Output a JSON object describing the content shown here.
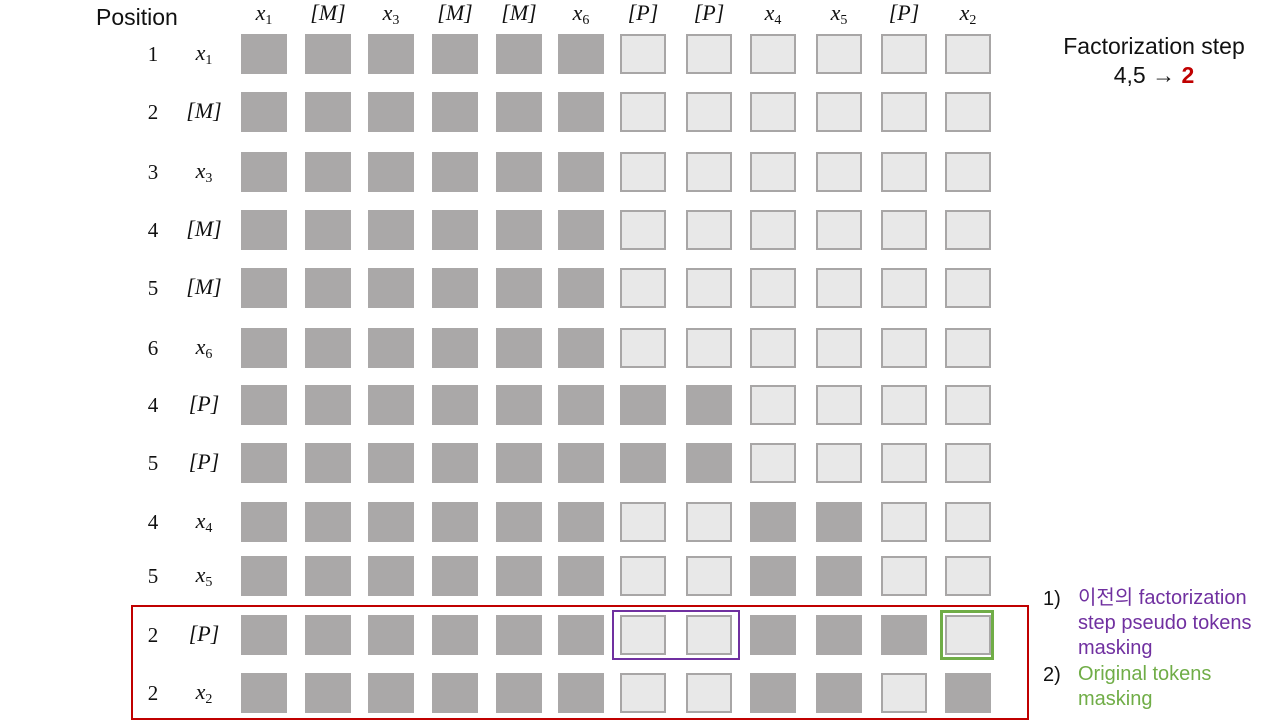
{
  "header": {
    "position_label": "Position"
  },
  "columns": [
    {
      "base": "x",
      "sub": "1"
    },
    {
      "base": "[M]",
      "sub": ""
    },
    {
      "base": "x",
      "sub": "3"
    },
    {
      "base": "[M]",
      "sub": ""
    },
    {
      "base": "[M]",
      "sub": ""
    },
    {
      "base": "x",
      "sub": "6"
    },
    {
      "base": "[P]",
      "sub": ""
    },
    {
      "base": "[P]",
      "sub": ""
    },
    {
      "base": "x",
      "sub": "4"
    },
    {
      "base": "x",
      "sub": "5"
    },
    {
      "base": "[P]",
      "sub": ""
    },
    {
      "base": "x",
      "sub": "2"
    }
  ],
  "rows": [
    {
      "pos": "1",
      "base": "x",
      "sub": "1",
      "mask": "111111000000"
    },
    {
      "pos": "2",
      "base": "[M]",
      "sub": "",
      "mask": "111111000000"
    },
    {
      "pos": "3",
      "base": "x",
      "sub": "3",
      "mask": "111111000000"
    },
    {
      "pos": "4",
      "base": "[M]",
      "sub": "",
      "mask": "111111000000"
    },
    {
      "pos": "5",
      "base": "[M]",
      "sub": "",
      "mask": "111111000000"
    },
    {
      "pos": "6",
      "base": "x",
      "sub": "6",
      "mask": "111111000000"
    },
    {
      "pos": "4",
      "base": "[P]",
      "sub": "",
      "mask": "111111110000"
    },
    {
      "pos": "5",
      "base": "[P]",
      "sub": "",
      "mask": "111111110000"
    },
    {
      "pos": "4",
      "base": "x",
      "sub": "4",
      "mask": "111111001100"
    },
    {
      "pos": "5",
      "base": "x",
      "sub": "5",
      "mask": "111111001100"
    },
    {
      "pos": "2",
      "base": "[P]",
      "sub": "",
      "mask": "111111001110"
    },
    {
      "pos": "2",
      "base": "x",
      "sub": "2",
      "mask": "111111001101"
    }
  ],
  "factorization": {
    "title": "Factorization step",
    "from": "4,5",
    "arrow": "→",
    "to": "2"
  },
  "notes": [
    {
      "num": "1)",
      "text": "이전의 factorization step pseudo tokens masking",
      "color": "#7030a0"
    },
    {
      "num": "2)",
      "text": "Original tokens masking",
      "color": "#70ad47"
    }
  ],
  "colors": {
    "masked_cell": "#aaa8a8",
    "open_cell": "#e8e8e8",
    "highlight_rows_frame": "#c00000",
    "pseudo_token_frame": "#7030a0",
    "original_token_frame": "#70ad47"
  }
}
